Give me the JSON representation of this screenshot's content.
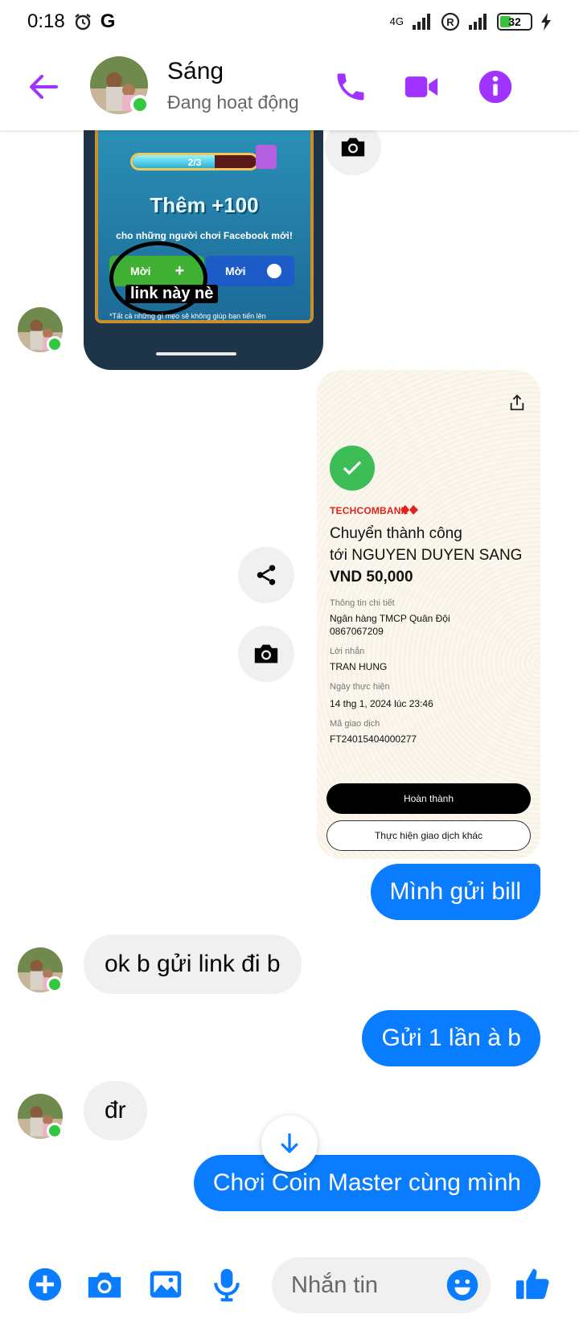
{
  "status_bar": {
    "time": "0:18",
    "g_icon": "G",
    "network": "4G",
    "battery": "32"
  },
  "header": {
    "contact_name": "Sáng",
    "contact_status": "Đang hoạt động",
    "icons": [
      "back-arrow",
      "phone",
      "video-camera",
      "info"
    ],
    "accent_color": "#a033ff"
  },
  "game_image": {
    "progress_text": "2/3",
    "progress_fraction": 0.66,
    "bonus_text": "Thêm +100",
    "subtitle": "cho những người chơi Facebook mới!",
    "invite_button": "Mời",
    "invite_messenger_button": "Mời",
    "annotation": "link này nè",
    "footnote": "*Tất cả những gì mẹo sẽ không giúp bạn tiến lên"
  },
  "receipt": {
    "bank": "TECHCOMBANK",
    "title_line1": "Chuyển thành công",
    "title_line2": "tới NGUYEN DUYEN SANG",
    "amount": "VND 50,000",
    "details_label": "Thông tin chi tiết",
    "recipient_bank": "Ngân hàng TMCP Quân Đội",
    "account_number": "0867067209",
    "message_label": "Lời nhắn",
    "message_value": "TRAN HUNG",
    "date_label": "Ngày thực hiện",
    "date_value": "14 thg 1, 2024 lúc 23:46",
    "txn_label": "Mã giao dịch",
    "txn_value": "FT24015404000277",
    "done_button": "Hoàn thành",
    "other_button": "Thực hiện giao dịch khác"
  },
  "messages": [
    {
      "direction": "out",
      "text": "Mình gửi bill"
    },
    {
      "direction": "in",
      "text": "ok b gửi link đi b"
    },
    {
      "direction": "out",
      "text": "Gửi 1 lần à b"
    },
    {
      "direction": "in",
      "text": "đr"
    },
    {
      "direction": "out",
      "text": "Chơi Coin Master cùng mình"
    }
  ],
  "composer": {
    "placeholder": "Nhắn tin",
    "icons": [
      "plus",
      "camera",
      "image",
      "microphone",
      "emoji",
      "thumbs-up"
    ],
    "icon_color": "#0a7cff"
  }
}
